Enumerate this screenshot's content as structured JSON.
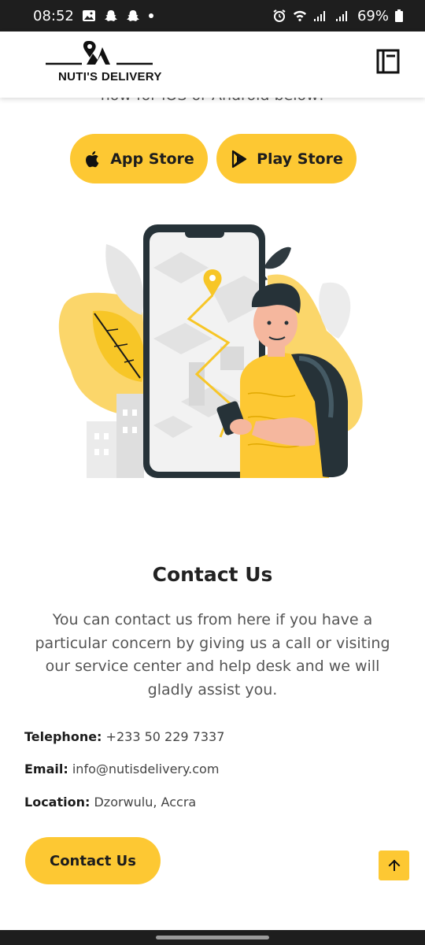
{
  "status_bar": {
    "time": "08:52",
    "battery": "69%"
  },
  "header": {
    "logo_text": "NUTI'S DELIVERY"
  },
  "download": {
    "cut_text": "now for iOS or Android below!",
    "app_store_label": "App Store",
    "play_store_label": "Play Store"
  },
  "contact": {
    "title": "Contact Us",
    "description": "You can contact us from here if you have a particular concern by giving us a call or visiting our service center and help desk and we will gladly assist you.",
    "telephone_label": "Telephone:",
    "telephone_value": "+233 50 229 7337",
    "email_label": "Email:",
    "email_value": "info@nutisdelivery.com",
    "location_label": "Location:",
    "location_value": "Dzorwulu, Accra",
    "button_label": "Contact Us"
  },
  "colors": {
    "accent": "#fdc833",
    "status_bar": "#1e1e1e"
  },
  "icons": [
    "gallery-icon",
    "snapchat-icon",
    "alarm-icon",
    "wifi-icon",
    "signal-icon",
    "battery-icon",
    "menu-book-icon",
    "apple-icon",
    "play-store-icon",
    "arrow-up-icon"
  ]
}
